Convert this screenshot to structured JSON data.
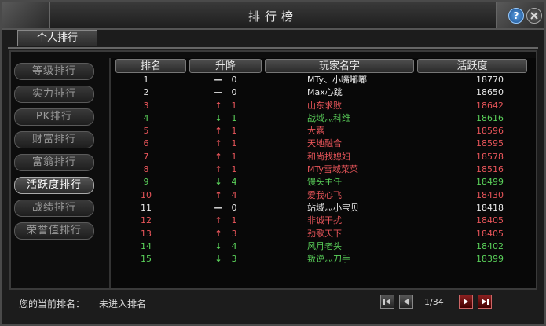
{
  "window": {
    "title": "排行榜"
  },
  "tab": {
    "label": "个人排行"
  },
  "sidebar": {
    "items": [
      {
        "label": "等级排行",
        "active": false
      },
      {
        "label": "实力排行",
        "active": false
      },
      {
        "label": "PK排行",
        "active": false
      },
      {
        "label": "财富排行",
        "active": false
      },
      {
        "label": "富翁排行",
        "active": false
      },
      {
        "label": "活跃度排行",
        "active": true
      },
      {
        "label": "战绩排行",
        "active": false
      },
      {
        "label": "荣誉值排行",
        "active": false
      }
    ]
  },
  "table": {
    "headers": [
      "排名",
      "升降",
      "玩家名字",
      "活跃度"
    ],
    "rows": [
      {
        "rank": "1",
        "arrow": "—",
        "delta": "0",
        "name": "MTy、小嘴嘟嘟",
        "score": "18770",
        "color": "#e8e8e8",
        "arrow_color": "#e8e8e8"
      },
      {
        "rank": "2",
        "arrow": "—",
        "delta": "0",
        "name": "Max心跳",
        "score": "18650",
        "color": "#e8e8e8",
        "arrow_color": "#e8e8e8"
      },
      {
        "rank": "3",
        "arrow": "↑",
        "delta": "1",
        "name": "山东求败",
        "score": "18642",
        "color": "#e8555a",
        "arrow_color": "#e8555a"
      },
      {
        "rank": "4",
        "arrow": "↓",
        "delta": "1",
        "name": "战域灬科维",
        "score": "18616",
        "color": "#5ad15a",
        "arrow_color": "#5ad15a"
      },
      {
        "rank": "5",
        "arrow": "↑",
        "delta": "1",
        "name": "大嘉",
        "score": "18596",
        "color": "#e8555a",
        "arrow_color": "#e8555a"
      },
      {
        "rank": "6",
        "arrow": "↑",
        "delta": "1",
        "name": "天地融合",
        "score": "18595",
        "color": "#e8555a",
        "arrow_color": "#e8555a"
      },
      {
        "rank": "7",
        "arrow": "↑",
        "delta": "1",
        "name": "和尚找媳妇",
        "score": "18578",
        "color": "#e8555a",
        "arrow_color": "#e8555a"
      },
      {
        "rank": "8",
        "arrow": "↑",
        "delta": "1",
        "name": "MTy雪域菜菜",
        "score": "18516",
        "color": "#e8555a",
        "arrow_color": "#e8555a"
      },
      {
        "rank": "9",
        "arrow": "↓",
        "delta": "4",
        "name": "馒头主任",
        "score": "18499",
        "color": "#5ad15a",
        "arrow_color": "#5ad15a"
      },
      {
        "rank": "10",
        "arrow": "↑",
        "delta": "4",
        "name": "爱我心飞",
        "score": "18430",
        "color": "#e8555a",
        "arrow_color": "#e8555a"
      },
      {
        "rank": "11",
        "arrow": "—",
        "delta": "0",
        "name": "站域灬小宝贝",
        "score": "18418",
        "color": "#e8e8e8",
        "arrow_color": "#e8e8e8"
      },
      {
        "rank": "12",
        "arrow": "↑",
        "delta": "1",
        "name": "非诚干扰",
        "score": "18405",
        "color": "#e8555a",
        "arrow_color": "#e8555a"
      },
      {
        "rank": "13",
        "arrow": "↑",
        "delta": "3",
        "name": "劲歌天下",
        "score": "18405",
        "color": "#e8555a",
        "arrow_color": "#e8555a"
      },
      {
        "rank": "14",
        "arrow": "↓",
        "delta": "4",
        "name": "风月老头",
        "score": "18402",
        "color": "#5ad15a",
        "arrow_color": "#5ad15a"
      },
      {
        "rank": "15",
        "arrow": "↓",
        "delta": "3",
        "name": "叛逆灬刀手",
        "score": "18399",
        "color": "#5ad15a",
        "arrow_color": "#5ad15a"
      }
    ]
  },
  "footer": {
    "label": "您的当前排名：",
    "value": "未进入排名",
    "page": "1/34"
  },
  "icons": {
    "help": "?",
    "first": "first-page-icon",
    "prev": "prev-page-icon",
    "next": "next-page-icon",
    "last": "last-page-icon"
  }
}
